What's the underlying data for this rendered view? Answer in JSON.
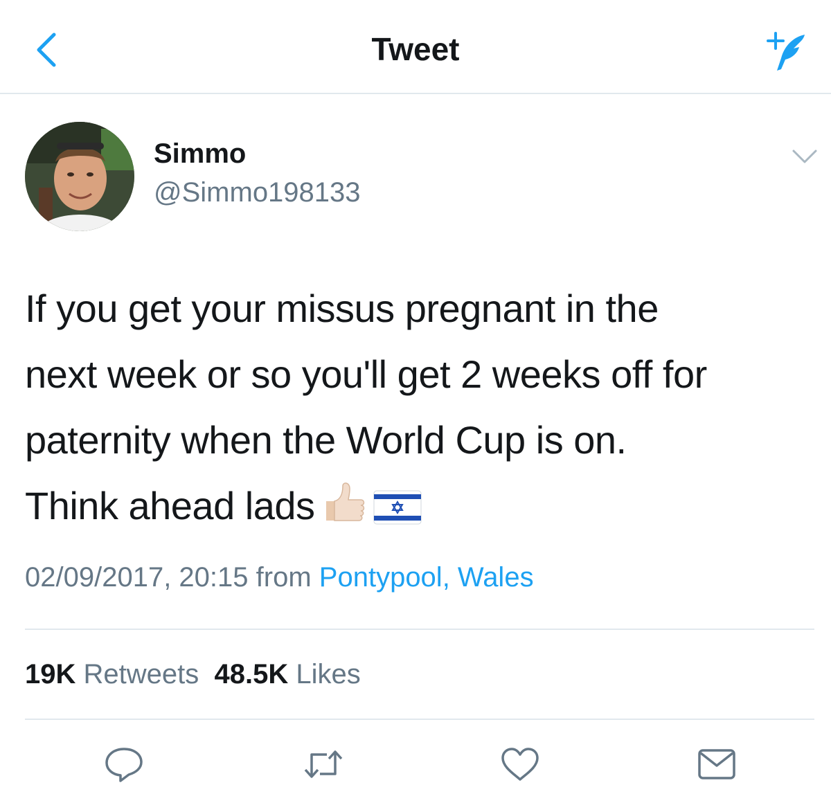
{
  "nav": {
    "title": "Tweet",
    "back_icon": "chevron-left-icon",
    "compose_icon": "compose-quill-icon"
  },
  "tweet": {
    "author": {
      "name": "Simmo",
      "handle": "@Simmo198133"
    },
    "text_lines": [
      "If you get your missus pregnant in the",
      "next week or so you'll get 2 weeks off for",
      "paternity when the World Cup is on.",
      "Think ahead lads"
    ],
    "emojis": [
      "thumbs-up-light-skin",
      "flag-israel"
    ],
    "datetime": "02/09/2017, 20:15",
    "from_label": "from",
    "location": "Pontypool, Wales",
    "stats": {
      "retweets_count": "19K",
      "retweets_label": "Retweets",
      "likes_count": "48.5K",
      "likes_label": "Likes"
    }
  },
  "actions": [
    "reply-icon",
    "retweet-icon",
    "like-icon",
    "share-mail-icon"
  ],
  "colors": {
    "accent": "#1da1f2",
    "secondary_text": "#657786",
    "divider": "#e1e8ed"
  }
}
